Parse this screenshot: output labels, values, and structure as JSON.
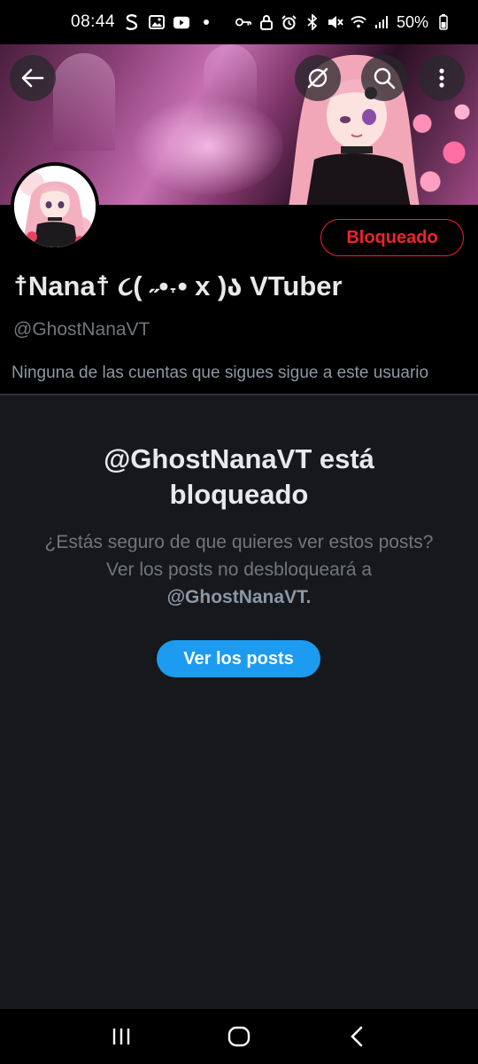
{
  "status_bar": {
    "time": "08:44",
    "battery": "50%",
    "left_icons": [
      "s-icon",
      "gallery-icon",
      "youtube-icon",
      "dot-icon"
    ],
    "right_icons": [
      "key-icon",
      "lock-icon",
      "alarm-icon",
      "bluetooth-icon",
      "mute-icon",
      "wifi-icon",
      "signal-icon",
      "battery-icon"
    ]
  },
  "profile": {
    "display_name": "☨Nana☨ ૮( ˶•˕• x )ა VTuber",
    "handle": "@GhostNanaVT",
    "blocked_label": "Bloqueado",
    "follow_note": "Ninguna de las cuentas que sigues sigue a este usuario"
  },
  "blocked_panel": {
    "title": "@GhostNanaVT está bloqueado",
    "text": "¿Estás seguro de que quieres ver estos posts? Ver los posts no desbloqueará a",
    "text_handle": "@GhostNanaVT.",
    "button_label": "Ver los posts"
  },
  "colors": {
    "accent": "#1d9bf0",
    "danger": "#f4212e",
    "background": "#000000",
    "panel": "#16181c"
  }
}
